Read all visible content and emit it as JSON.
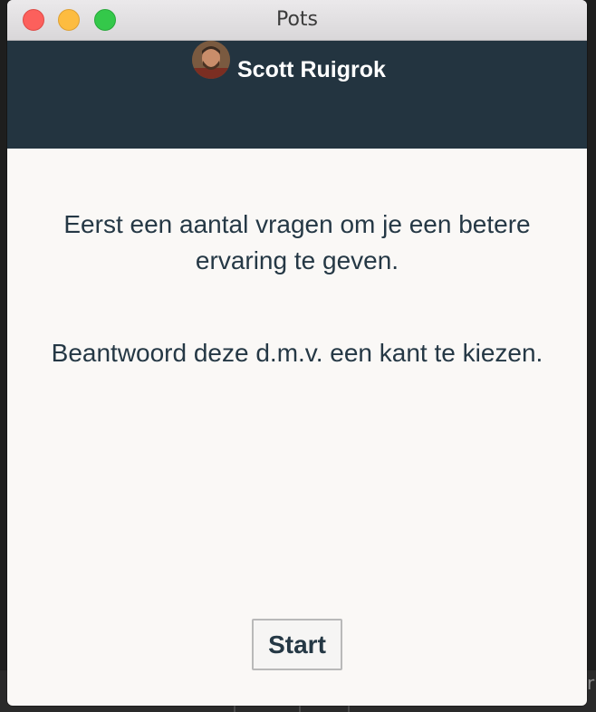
{
  "window": {
    "title": "Pots"
  },
  "header": {
    "user_name": "Scott Ruigrok",
    "background_color": "#233440"
  },
  "main": {
    "intro_text": "Eerst een aantal vragen om je een betere ervaring te geven.",
    "instruction_text": "Beantwoord deze d.m.v. een kant te kiezen.",
    "start_label": "Start",
    "text_color": "#253845"
  },
  "background": {
    "partial_glyph": "r"
  },
  "icons": {
    "close": "close-icon",
    "minimize": "minimize-icon",
    "zoom": "zoom-icon",
    "avatar": "avatar"
  }
}
